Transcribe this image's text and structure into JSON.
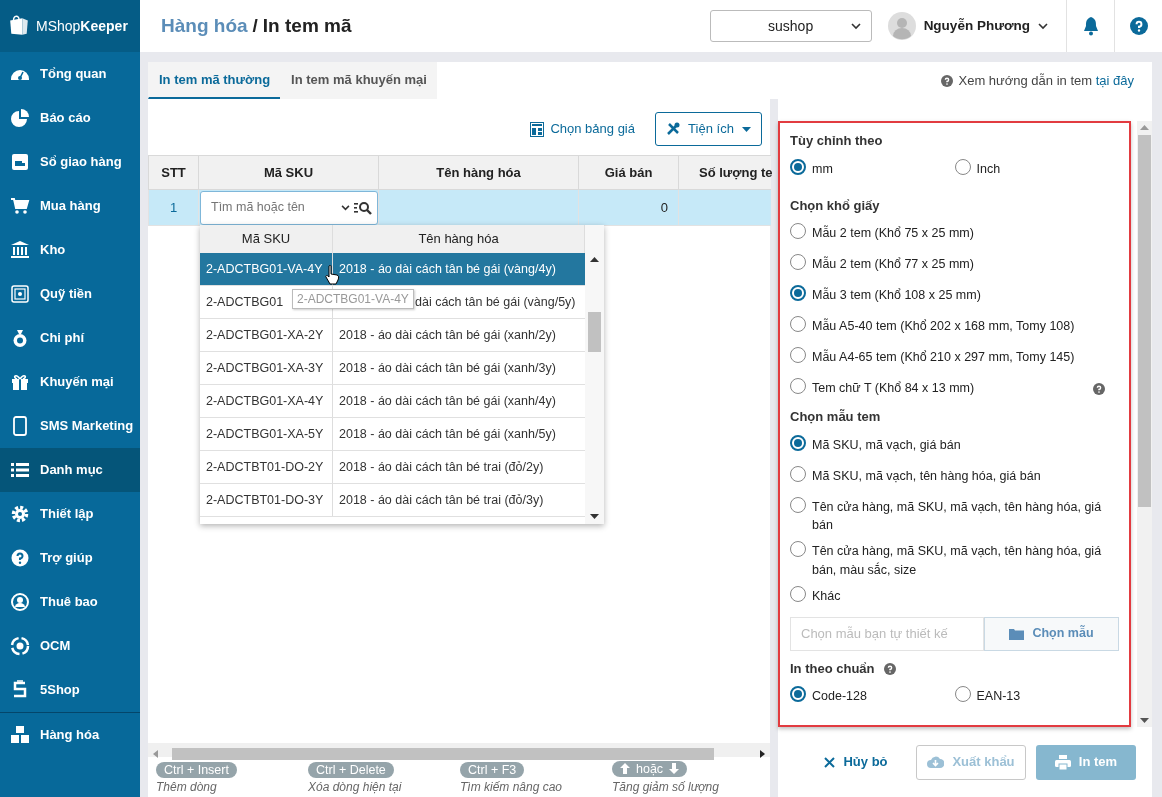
{
  "app": {
    "logo": "MShop**Keeper**"
  },
  "sidebar": {
    "items": [
      {
        "label": "Tổng quan",
        "selected": false
      },
      {
        "label": "Báo cáo",
        "selected": false
      },
      {
        "label": "Sổ giao hàng",
        "selected": false
      },
      {
        "label": "Mua hàng",
        "selected": false
      },
      {
        "label": "Kho",
        "selected": false
      },
      {
        "label": "Quỹ tiền",
        "selected": false
      },
      {
        "label": "Chi phí",
        "selected": false
      },
      {
        "label": "Khuyến mại",
        "selected": false
      },
      {
        "label": "SMS Marketing",
        "selected": false
      },
      {
        "label": "Danh mục",
        "selected": true
      },
      {
        "label": "Thiết lập",
        "selected": false
      },
      {
        "label": "Trợ giúp",
        "selected": false
      },
      {
        "label": "Thuê bao",
        "selected": false
      },
      {
        "label": "OCM",
        "selected": false
      },
      {
        "label": "5Shop",
        "selected": false
      }
    ],
    "footer_item": {
      "label": "Hàng hóa"
    }
  },
  "header": {
    "breadcrumb_parent": "Hàng hóa",
    "separator": "/",
    "breadcrumb_current": "In tem mã",
    "shop_select": {
      "value": "sushop"
    },
    "user": {
      "name": "Nguyễn Phương"
    }
  },
  "tabs": [
    {
      "label": "In tem mã thường",
      "selected": true
    },
    {
      "label": "In tem mã khuyến mại",
      "selected": false
    }
  ],
  "guide": {
    "text": "Xem hướng dẫn in tem",
    "link": "tại đây"
  },
  "toolbar": {
    "price_list_link": "Chọn bảng giá",
    "utilities_button": "Tiện ích"
  },
  "table": {
    "columns": [
      "STT",
      "Mã SKU",
      "Tên hàng hóa",
      "Giá bán",
      "Số lượng te"
    ],
    "rows": [
      {
        "stt": "1",
        "search_placeholder": "Tìm mã hoặc tên",
        "price": "0",
        "selected": true
      }
    ]
  },
  "dropdown": {
    "columns": [
      "Mã SKU",
      "Tên hàng hóa"
    ],
    "rows": [
      {
        "sku": "2-ADCTBG01-VA-4Y",
        "name": "2018 - áo dài cách tân bé gái (vàng/4y)",
        "selected": true,
        "covered": false
      },
      {
        "sku": "2-ADCTBG01",
        "name": "dài cách tân bé gái (vàng/5y)",
        "selected": false,
        "covered": true
      },
      {
        "sku": "2-ADCTBG01-XA-2Y",
        "name": "2018 - áo dài cách tân bé gái (xanh/2y)",
        "selected": false,
        "covered": false
      },
      {
        "sku": "2-ADCTBG01-XA-3Y",
        "name": "2018 - áo dài cách tân bé gái (xanh/3y)",
        "selected": false,
        "covered": false
      },
      {
        "sku": "2-ADCTBG01-XA-4Y",
        "name": "2018 - áo dài cách tân bé gái (xanh/4y)",
        "selected": false,
        "covered": false
      },
      {
        "sku": "2-ADCTBG01-XA-5Y",
        "name": "2018 - áo dài cách tân bé gái (xanh/5y)",
        "selected": false,
        "covered": false
      },
      {
        "sku": "2-ADCTBT01-DO-2Y",
        "name": "2018 - áo dài cách tân bé trai (đỏ/2y)",
        "selected": false,
        "covered": false
      },
      {
        "sku": "2-ADCTBT01-DO-3Y",
        "name": "2018 - áo dài cách tân bé trai (đỏ/3y)",
        "selected": false,
        "covered": false
      }
    ],
    "tooltip": "2-ADCTBG01-VA-4Y"
  },
  "shortcuts": [
    {
      "kind": "keys",
      "keys": "Ctrl + Insert",
      "description": "Thêm dòng"
    },
    {
      "kind": "keys",
      "keys": "Ctrl + Delete",
      "description": "Xóa dòng hiện tại"
    },
    {
      "kind": "keys",
      "keys": "Ctrl + F3",
      "description": "Tìm kiếm nâng cao"
    },
    {
      "kind": "arrows",
      "keys": "hoặc",
      "description": "Tăng giảm số lượng"
    }
  ],
  "settings": {
    "unit": {
      "title": "Tùy chỉnh theo",
      "options": [
        {
          "label": "mm",
          "selected": true
        },
        {
          "label": "Inch",
          "selected": false
        }
      ]
    },
    "paper": {
      "title": "Chọn khổ giấy",
      "options": [
        {
          "label": "Mẫu 2 tem (Khổ 75 x 25 mm)",
          "selected": false
        },
        {
          "label": "Mẫu 2 tem (Khổ 77 x 25 mm)",
          "selected": false
        },
        {
          "label": "Mẫu 3 tem (Khổ 108 x 25 mm)",
          "selected": true
        },
        {
          "label": "Mẫu A5-40 tem (Khổ 202 x 168 mm, Tomy 108)",
          "selected": false
        },
        {
          "label": "Mẫu A4-65 tem (Khổ 210 x 297 mm, Tomy 145)",
          "selected": false
        },
        {
          "label": "Tem chữ T (Khổ 84 x 13 mm)",
          "selected": false,
          "help": true
        }
      ]
    },
    "template": {
      "title": "Chọn mẫu tem",
      "options": [
        {
          "label": "Mã SKU, mã vạch, giá bán",
          "selected": true
        },
        {
          "label": "Mã SKU, mã vạch, tên hàng hóa, giá bán",
          "selected": false
        },
        {
          "label": "Tên cửa hàng, mã SKU, mã vạch, tên hàng hóa, giá bán",
          "selected": false
        },
        {
          "label": "Tên cửa hàng, mã SKU, mã vạch, tên hàng hóa, giá bán, màu sắc, size",
          "selected": false
        },
        {
          "label": "Khác",
          "selected": false
        }
      ]
    },
    "custom_template": {
      "placeholder": "Chọn mẫu bạn tự thiết kế",
      "button": "Chọn mẫu"
    },
    "standard": {
      "title": "In theo chuẩn",
      "options": [
        {
          "label": "Code-128",
          "selected": true
        },
        {
          "label": "EAN-13",
          "selected": false
        }
      ]
    }
  },
  "actions": [
    {
      "kind": "cancel",
      "label": "Hủy bỏ",
      "disabled": false
    },
    {
      "kind": "export",
      "label": "Xuất khẩu",
      "disabled": true
    },
    {
      "kind": "print",
      "label": "In tem",
      "disabled": true
    }
  ]
}
